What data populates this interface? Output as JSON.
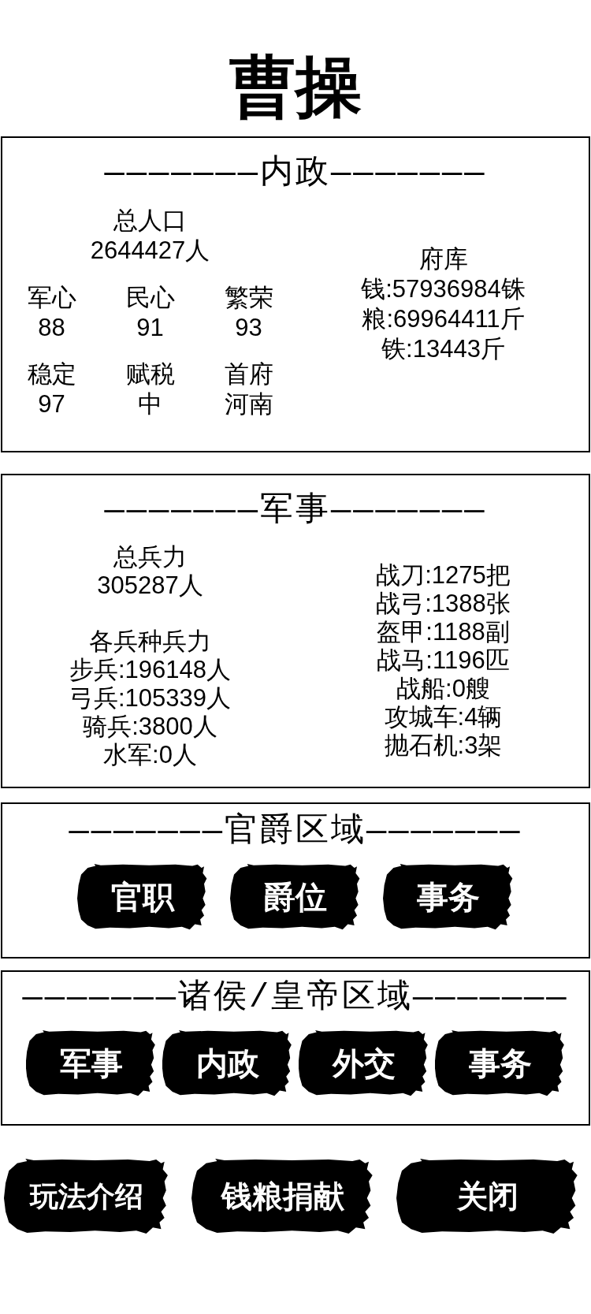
{
  "title": "曹操",
  "domestic": {
    "header": "———————内政———————",
    "population": {
      "label": "总人口",
      "value": "2644427人"
    },
    "stats": [
      {
        "label": "军心",
        "value": "88"
      },
      {
        "label": "民心",
        "value": "91"
      },
      {
        "label": "繁荣",
        "value": "93"
      },
      {
        "label": "稳定",
        "value": "97"
      },
      {
        "label": "赋税",
        "value": "中"
      },
      {
        "label": "首府",
        "value": "河南"
      }
    ],
    "treasury": {
      "label": "府库",
      "lines": [
        "钱:57936984铢",
        "粮:69964411斤",
        "铁:13443斤"
      ]
    }
  },
  "military": {
    "header": "———————军事———————",
    "total": {
      "label": "总兵力",
      "value": "305287人"
    },
    "troops": {
      "label": "各兵种兵力",
      "lines": [
        "步兵:196148人",
        "弓兵:105339人",
        "骑兵:3800人",
        "水军:0人"
      ]
    },
    "equipment": [
      "战刀:1275把",
      "战弓:1388张",
      "盔甲:1188副",
      "战马:1196匹",
      "战船:0艘",
      "攻城车:4辆",
      "抛石机:3架"
    ]
  },
  "rank_area": {
    "header": "———————官爵区域———————",
    "buttons": [
      "官职",
      "爵位",
      "事务"
    ]
  },
  "lord_area": {
    "header": "———————诸侯/皇帝区域———————",
    "buttons": [
      "军事",
      "内政",
      "外交",
      "事务"
    ]
  },
  "footer_buttons": [
    "玩法介绍",
    "钱粮捐献",
    "关闭"
  ]
}
